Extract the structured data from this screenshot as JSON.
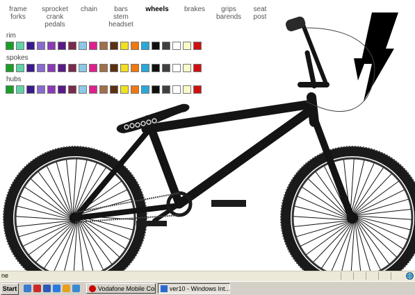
{
  "nav": [
    {
      "lines": [
        "frame",
        "forks"
      ],
      "active": false
    },
    {
      "lines": [
        "sprocket",
        "crank",
        "pedals"
      ],
      "active": false
    },
    {
      "lines": [
        "chain"
      ],
      "active": false
    },
    {
      "lines": [
        "bars",
        "stem",
        "headset"
      ],
      "active": false
    },
    {
      "lines": [
        "wheels"
      ],
      "active": true
    },
    {
      "lines": [
        "brakes"
      ],
      "active": false
    },
    {
      "lines": [
        "grips",
        "barends"
      ],
      "active": false
    },
    {
      "lines": [
        "seat",
        "post"
      ],
      "active": false
    }
  ],
  "sections": [
    {
      "label": "rim"
    },
    {
      "label": "spokes"
    },
    {
      "label": "hubs"
    }
  ],
  "palette": [
    "#1a9e28",
    "#5fd3a8",
    "#3a1a8e",
    "#8a6ad0",
    "#8a3ab8",
    "#5a1a8a",
    "#7a2a4a",
    "#8ec8e8",
    "#e0208a",
    "#a0704a",
    "#5a3010",
    "#f0e020",
    "#f07810",
    "#2aa8d8",
    "#101010",
    "#404040",
    "#ffffff",
    "#fafac8",
    "#d01010"
  ],
  "bike_logo_text": "",
  "statusbar": {
    "text": "ne"
  },
  "taskbar": {
    "start_label": "Start",
    "tasks": [
      {
        "label": "Vodafone Mobile Connect",
        "active": false,
        "icon_color": "#cc0000"
      },
      {
        "label": "ver10 - Windows Int...",
        "active": true,
        "icon_color": "#2a6ad0"
      }
    ],
    "quicklaunch": [
      "#3a7ad0",
      "#cc2a2a",
      "#2a5ab8",
      "#2a7ae0",
      "#e8a020",
      "#3a8ad0"
    ]
  }
}
